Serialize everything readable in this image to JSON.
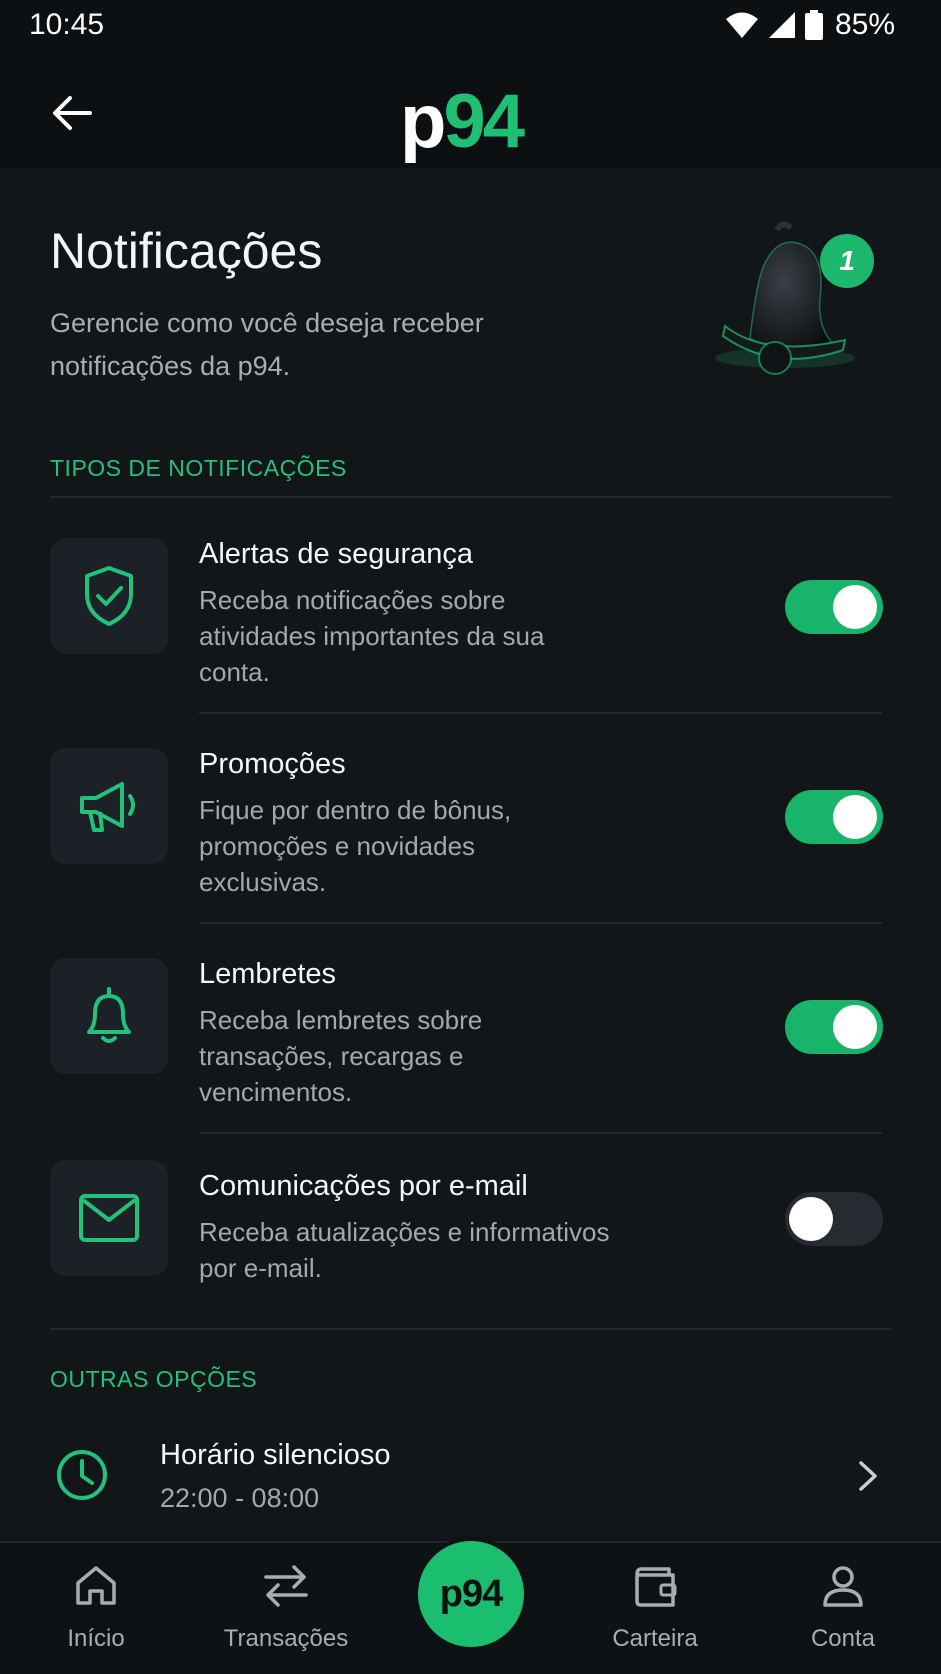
{
  "status": {
    "time": "10:45",
    "battery": "85%"
  },
  "appbar": {
    "logo_p": "p",
    "logo_num": "94"
  },
  "header": {
    "title": "Notificações",
    "subtitle": "Gerencie como você deseja receber notificações da p94.",
    "badge_count": "1"
  },
  "sections": {
    "types_label": "TIPOS DE NOTIFICAÇÕES",
    "other_label": "OUTRAS OPÇÕES"
  },
  "notifications": [
    {
      "icon": "shield-check-icon",
      "title": "Alertas de segurança",
      "description": "Receba notificações sobre atividades importantes da sua conta.",
      "enabled": true
    },
    {
      "icon": "megaphone-icon",
      "title": "Promoções",
      "description": "Fique por dentro de bônus, promoções e novidades exclusivas.",
      "enabled": true
    },
    {
      "icon": "bell-icon",
      "title": "Lembretes",
      "description": "Receba lembretes sobre transações, recargas e vencimentos.",
      "enabled": true
    },
    {
      "icon": "mail-icon",
      "title": "Comunicações por e-mail",
      "description": "Receba atualizações e informativos por e-mail.",
      "enabled": false
    }
  ],
  "quiet_hours": {
    "title": "Horário silencioso",
    "value": "22:00 - 08:00"
  },
  "bottom_nav": {
    "items": [
      {
        "label": "Início",
        "icon": "home-icon"
      },
      {
        "label": "Transações",
        "icon": "transfer-arrows-icon"
      },
      {
        "label": "Carteira",
        "icon": "wallet-icon"
      },
      {
        "label": "Conta",
        "icon": "user-icon"
      }
    ],
    "center_label": "p94"
  },
  "colors": {
    "accent": "#1fbf74",
    "background": "#121619",
    "tile": "#1b2126"
  }
}
